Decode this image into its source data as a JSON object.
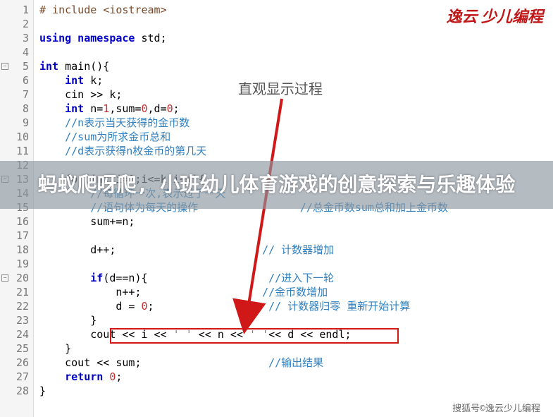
{
  "logo": "逸云 少儿编程",
  "annotation": "直观显示过程",
  "overlay_title": "蚂蚁爬呀爬, 小班幼儿体育游戏的创意探索与乐趣体验",
  "footer": "搜狐号©逸云少儿编程",
  "gutter": {
    "lines": [
      {
        "n": "1",
        "fold": ""
      },
      {
        "n": "2",
        "fold": ""
      },
      {
        "n": "3",
        "fold": ""
      },
      {
        "n": "4",
        "fold": ""
      },
      {
        "n": "5",
        "fold": "−"
      },
      {
        "n": "6",
        "fold": ""
      },
      {
        "n": "7",
        "fold": ""
      },
      {
        "n": "8",
        "fold": ""
      },
      {
        "n": "9",
        "fold": ""
      },
      {
        "n": "10",
        "fold": ""
      },
      {
        "n": "11",
        "fold": ""
      },
      {
        "n": "12",
        "fold": ""
      },
      {
        "n": "13",
        "fold": "−"
      },
      {
        "n": "14",
        "fold": ""
      },
      {
        "n": "15",
        "fold": ""
      },
      {
        "n": "16",
        "fold": ""
      },
      {
        "n": "17",
        "fold": ""
      },
      {
        "n": "18",
        "fold": ""
      },
      {
        "n": "19",
        "fold": ""
      },
      {
        "n": "20",
        "fold": "−"
      },
      {
        "n": "21",
        "fold": ""
      },
      {
        "n": "22",
        "fold": ""
      },
      {
        "n": "23",
        "fold": ""
      },
      {
        "n": "24",
        "fold": ""
      },
      {
        "n": "25",
        "fold": ""
      },
      {
        "n": "26",
        "fold": ""
      },
      {
        "n": "27",
        "fold": ""
      },
      {
        "n": "28",
        "fold": ""
      }
    ]
  },
  "code": {
    "l1_a": "# include ",
    "l1_b": "<iostream>",
    "l3_a": "using",
    "l3_b": " namespace ",
    "l3_c": "std",
    "l5_a": "int",
    "l5_b": " main",
    "l6_a": "    int",
    "l6_b": " k",
    "l7": "    cin >> k;",
    "l8_a": "    int",
    "l8_b": " n=",
    "l8_c": "1",
    "l8_d": ",sum=",
    "l8_e": "0",
    "l8_f": ",d=",
    "l8_g": "0",
    "l9": "    //n表示当天获得的金币数",
    "l10": "    //sum为所求金币总和",
    "l11": "    //d表示获得n枚金币的第几天",
    "l13_a": "    for(int i=1;i<=k;i++){",
    "l14": "        //每循环一次,表示过了一天",
    "l15": "        //语句体为每天的操作",
    "l15_c": "                //总金币数sum总和加上金币数",
    "l16": "        sum+=n;",
    "l18": "        d++;",
    "l18_c": "                       // 计数器增加",
    "l20_a": "        if",
    "l20_b": "(d==n){",
    "l20_c": "                   //进入下一轮",
    "l21": "            n++;",
    "l21_c": "                   //金币数增加",
    "l22_a": "            d = ",
    "l22_b": "0",
    "l22_c": "                  // 计数器归零 重新开始计算",
    "l23": "        }",
    "l24_a": "        cout << i << ",
    "l24_b": "' '",
    "l24_c": " << n << ",
    "l24_d": "' '",
    "l24_e": "<< d << endl;",
    "l25": "    }",
    "l26": "    cout << sum;",
    "l26_c": "                    //输出结果",
    "l27_a": "    return ",
    "l27_b": "0",
    "l28": "}"
  }
}
